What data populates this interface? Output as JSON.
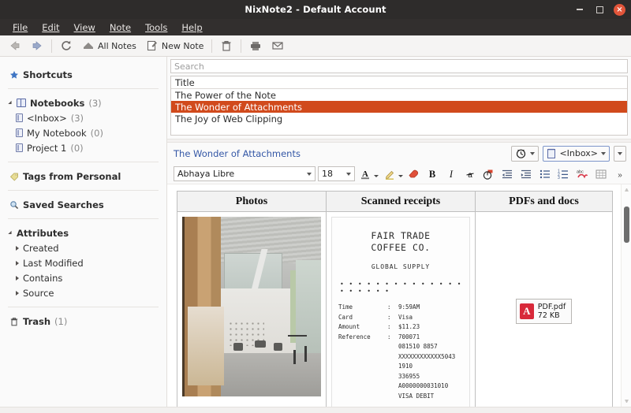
{
  "window": {
    "title": "NixNote2 - Default Account",
    "controls": {
      "minimize": "minimize-icon",
      "maximize": "maximize-icon",
      "close": "×"
    }
  },
  "menubar": {
    "items": [
      {
        "label": "File",
        "mnemonic": "F"
      },
      {
        "label": "Edit",
        "mnemonic": "E"
      },
      {
        "label": "View",
        "mnemonic": "V"
      },
      {
        "label": "Note",
        "mnemonic": "N"
      },
      {
        "label": "Tools",
        "mnemonic": "T"
      },
      {
        "label": "Help",
        "mnemonic": "H"
      }
    ]
  },
  "toolbar": {
    "back": "back-arrow-icon",
    "forward": "forward-arrow-icon",
    "sync": "sync-icon",
    "all_notes_label": "All Notes",
    "new_note_label": "New Note",
    "delete": "trash-icon",
    "print": "printer-icon",
    "email": "envelope-icon"
  },
  "sidebar": {
    "shortcuts": {
      "label": "Shortcuts",
      "icon": "star-icon"
    },
    "notebooks": {
      "label": "Notebooks",
      "count": "(3)",
      "icon": "notebooks-icon",
      "children": [
        {
          "label": "<Inbox>",
          "count": "(3)",
          "icon": "notebook-icon"
        },
        {
          "label": "My Notebook",
          "count": "(0)",
          "icon": "notebook-icon"
        },
        {
          "label": "Project 1",
          "count": "(0)",
          "icon": "notebook-icon"
        }
      ]
    },
    "tags": {
      "label": "Tags from Personal",
      "icon": "tag-icon"
    },
    "saved_searches": {
      "label": "Saved Searches",
      "icon": "magnifier-icon"
    },
    "attributes": {
      "label": "Attributes",
      "children": [
        {
          "label": "Created"
        },
        {
          "label": "Last Modified"
        },
        {
          "label": "Contains"
        },
        {
          "label": "Source"
        }
      ]
    },
    "trash": {
      "label": "Trash",
      "count": "(1)",
      "icon": "trash-icon"
    }
  },
  "search": {
    "placeholder": "Search",
    "value": ""
  },
  "notelist": {
    "column_header": "Title",
    "rows": [
      {
        "title": "The Power of the Note",
        "selected": false
      },
      {
        "title": "The Wonder of Attachments",
        "selected": true
      },
      {
        "title": "The Joy of Web Clipping",
        "selected": false
      }
    ],
    "selection_color": "#d14a1c"
  },
  "note_header": {
    "title": "The Wonder of Attachments",
    "reminder_icon": "alarm-clock-icon",
    "notebook_icon": "notebook-icon",
    "notebook_value": "<Inbox>",
    "more_label": "more-options"
  },
  "format_toolbar": {
    "font_family": "Abhaya Libre",
    "font_size": "18",
    "buttons": [
      {
        "name": "font-color-icon",
        "glyph": "A"
      },
      {
        "name": "highlight-color-icon",
        "glyph": "✎"
      },
      {
        "name": "erase-format-icon",
        "glyph": "◗"
      },
      {
        "name": "bold-icon",
        "glyph": "B"
      },
      {
        "name": "italic-icon",
        "glyph": "I"
      },
      {
        "name": "strikethrough-icon",
        "glyph": "a"
      },
      {
        "name": "todo-checkbox-icon",
        "glyph": "☑"
      },
      {
        "name": "indent-decrease-icon",
        "glyph": "⇤"
      },
      {
        "name": "indent-increase-icon",
        "glyph": "⇥"
      },
      {
        "name": "bullet-list-icon",
        "glyph": "•"
      },
      {
        "name": "numbered-list-icon",
        "glyph": "1."
      },
      {
        "name": "spellcheck-icon",
        "glyph": "abc"
      },
      {
        "name": "insert-table-icon",
        "glyph": "▦"
      },
      {
        "name": "overflow-icon",
        "glyph": "»"
      }
    ]
  },
  "note_content": {
    "table_headers": [
      "Photos",
      "Scanned receipts",
      "PDFs and docs"
    ],
    "photo": {
      "alt": "office lobby interior photo"
    },
    "receipt": {
      "merchant_line1": "FAIR TRADE",
      "merchant_line2": "COFFEE CO.",
      "subtitle": "GLOBAL SUPPLY",
      "divider": "• • • • • • • • • • • • • • • • • • • •",
      "fields": [
        {
          "key": "Time",
          "sep": ":",
          "value": "9:59AM"
        },
        {
          "key": "Card",
          "sep": ":",
          "value": "Visa"
        },
        {
          "key": "Amount",
          "sep": ":",
          "value": "$11.23"
        }
      ],
      "reference_key": "Reference",
      "reference_sep": ":",
      "reference_lines": [
        "700071",
        "081510 8857",
        "XXXXXXXXXXXX5043",
        "1910",
        "336955",
        "A0000000031010",
        "VISA DEBIT"
      ]
    },
    "attachment": {
      "icon": "pdf-file-icon",
      "name": "PDF.pdf",
      "size": "72 KB"
    }
  },
  "colors": {
    "titlebar": "#2e2c2b",
    "close_button": "#e2553a",
    "selection": "#d14a1c",
    "note_title_link": "#3457a6",
    "pdf_red": "#d8293a"
  }
}
